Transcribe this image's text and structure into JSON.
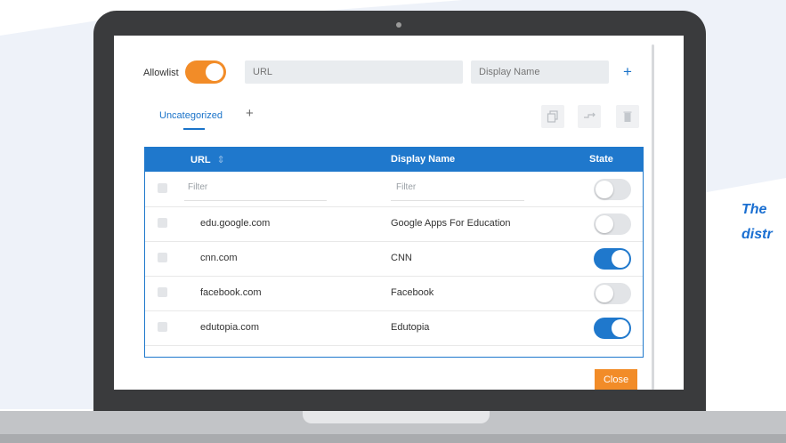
{
  "colors": {
    "accent_blue": "#1f78cc",
    "accent_orange": "#f28c28",
    "caption_blue": "#1a6fd1"
  },
  "caption": {
    "line1": "The",
    "line2": "distr"
  },
  "toolbar": {
    "allowlist_label": "Allowlist",
    "allowlist_enabled": true,
    "url_placeholder": "URL",
    "display_name_placeholder": "Display Name",
    "add_icon": "plus-icon"
  },
  "tabs": [
    {
      "label": "Uncategorized",
      "active": true
    }
  ],
  "actions": {
    "icons": [
      "copy-icon",
      "move-icon",
      "trash-icon"
    ]
  },
  "table": {
    "headers": {
      "url": "URL",
      "display_name": "Display Name",
      "state": "State"
    },
    "filter": {
      "url_placeholder": "Filter",
      "display_name_placeholder": "Filter",
      "state_on": false
    },
    "rows": [
      {
        "url": "edu.google.com",
        "display_name": "Google Apps For Education",
        "state_on": false
      },
      {
        "url": "cnn.com",
        "display_name": "CNN",
        "state_on": true
      },
      {
        "url": "facebook.com",
        "display_name": "Facebook",
        "state_on": false
      },
      {
        "url": "edutopia.com",
        "display_name": "Edutopia",
        "state_on": true
      }
    ]
  },
  "footer": {
    "close_label": "Close"
  }
}
